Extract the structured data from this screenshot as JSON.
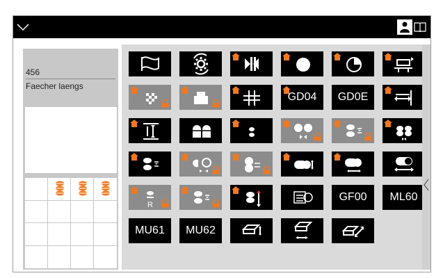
{
  "topbar": {
    "menu_icon": "chevron-down-icon",
    "user_icon": "user-icon",
    "book_icon": "book-icon"
  },
  "info": {
    "number": "456",
    "name": "Faecher laengs"
  },
  "buttons": [
    {
      "name": "flag-button",
      "icon": "flag-icon",
      "label": "",
      "style": "black",
      "lock": false
    },
    {
      "name": "gear-rotate-button",
      "icon": "gear-rotate-icon",
      "label": "",
      "style": "black",
      "lock": false
    },
    {
      "name": "center-align-button",
      "icon": "center-align-icon",
      "label": "",
      "style": "black",
      "lock": false,
      "home": true
    },
    {
      "name": "circle-button",
      "icon": "circle-icon",
      "label": "",
      "style": "black",
      "lock": false,
      "home": true
    },
    {
      "name": "pie-button",
      "icon": "pie-icon",
      "label": "",
      "style": "black",
      "lock": false,
      "home": true
    },
    {
      "name": "table-push-button",
      "icon": "table-push-icon",
      "label": "",
      "style": "black",
      "lock": false,
      "home": true
    },
    {
      "name": "checker-button",
      "icon": "checker-icon",
      "label": "",
      "style": "gray",
      "lock": true,
      "home": true
    },
    {
      "name": "weight-button",
      "icon": "weight-icon",
      "label": "",
      "style": "gray",
      "lock": true,
      "home": true
    },
    {
      "name": "hash-button",
      "icon": "hash-icon",
      "label": "",
      "style": "black",
      "lock": false,
      "home": true
    },
    {
      "name": "gd04-button",
      "icon": "",
      "label": "GD04",
      "style": "black",
      "lock": false,
      "home": true
    },
    {
      "name": "gd0e-button",
      "icon": "",
      "label": "GD0E",
      "style": "black",
      "lock": false
    },
    {
      "name": "width-stop-button",
      "icon": "width-stop-icon",
      "label": "",
      "style": "black",
      "lock": false,
      "home": true
    },
    {
      "name": "height-stop-button",
      "icon": "height-stop-icon",
      "label": "",
      "style": "black",
      "lock": false,
      "home": true
    },
    {
      "name": "rolls-pair-button",
      "icon": "rolls-pair-icon",
      "label": "",
      "style": "black",
      "lock": false
    },
    {
      "name": "small-rolls-button",
      "icon": "small-rolls-icon",
      "label": "",
      "style": "black",
      "lock": false,
      "home": true
    },
    {
      "name": "rolls-center-button",
      "icon": "rolls-center-icon",
      "label": "",
      "style": "gray",
      "lock": true,
      "home": true
    },
    {
      "name": "rolls-stack-button",
      "icon": "rolls-stack-icon",
      "label": "",
      "style": "gray",
      "lock": true,
      "home": true
    },
    {
      "name": "rolls-double-button",
      "icon": "rolls-double-icon",
      "label": "",
      "style": "black",
      "lock": false,
      "home": true
    },
    {
      "name": "rolls-stack-black-button",
      "icon": "rolls-stack-icon",
      "label": "",
      "style": "black",
      "lock": false,
      "home": true
    },
    {
      "name": "rolls-open-button",
      "icon": "rolls-open-icon",
      "label": "",
      "style": "gray",
      "lock": true,
      "home": true
    },
    {
      "name": "rolls-open2-button",
      "icon": "rolls-open2-icon",
      "label": "",
      "style": "gray",
      "lock": true,
      "home": true
    },
    {
      "name": "roller-vertical-button",
      "icon": "roller-vertical-icon",
      "label": "",
      "style": "black",
      "lock": false,
      "home": true
    },
    {
      "name": "roller-horizontal-button",
      "icon": "roller-horizontal-icon",
      "label": "",
      "style": "black",
      "lock": false,
      "home": true
    },
    {
      "name": "roller-width-button",
      "icon": "roller-width-icon",
      "label": "",
      "style": "black",
      "lock": false
    },
    {
      "name": "roller-r-button",
      "icon": "roller-r-icon",
      "label": "",
      "style": "gray",
      "lock": true,
      "home": true
    },
    {
      "name": "rolls-stack-gray-button",
      "icon": "rolls-stack-icon",
      "label": "",
      "style": "gray",
      "lock": true,
      "home": true
    },
    {
      "name": "roll-lift-button",
      "icon": "roll-lift-icon",
      "label": "",
      "style": "black",
      "lock": false,
      "home": true
    },
    {
      "name": "counter-button",
      "icon": "counter-icon",
      "label": "",
      "style": "black",
      "lock": false
    },
    {
      "name": "gf00-button",
      "icon": "",
      "label": "GF00",
      "style": "black",
      "lock": false
    },
    {
      "name": "ml60-button",
      "icon": "",
      "label": "ML60",
      "style": "black",
      "lock": false
    },
    {
      "name": "mu61-button",
      "icon": "",
      "label": "MU61",
      "style": "black",
      "lock": false
    },
    {
      "name": "mu62-button",
      "icon": "",
      "label": "MU62",
      "style": "black",
      "lock": false
    },
    {
      "name": "plate-vertical-button",
      "icon": "plate-vertical-icon",
      "label": "",
      "style": "black",
      "lock": false
    },
    {
      "name": "plate-horizontal-button",
      "icon": "plate-horizontal-icon",
      "label": "",
      "style": "black",
      "lock": false
    },
    {
      "name": "plate-diagonal-button",
      "icon": "plate-diagonal-icon",
      "label": "",
      "style": "black",
      "lock": false
    }
  ],
  "colors": {
    "home_orange": "#f07820",
    "lock_orange": "#f07820",
    "button_black": "#000000",
    "button_gray": "#8c8c8c",
    "panel_gray": "#c8c8c8"
  },
  "sidebar": {
    "arrow_icon": "chevron-left-icon"
  }
}
